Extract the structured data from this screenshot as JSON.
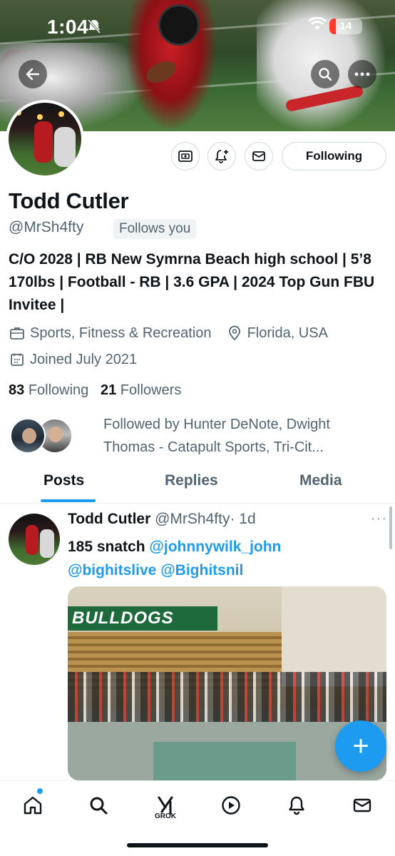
{
  "status_bar": {
    "time": "1:04",
    "battery": "14",
    "battery_level": 0.14
  },
  "profile": {
    "name": "Todd Cutler",
    "handle": "@MrSh4fty",
    "follows_you": "Follows you",
    "bio": "C/O 2028 | RB New Symrna Beach high school | 5’8 170lbs | Football - RB | 3.6 GPA | 2024 Top Gun FBU Invitee |",
    "category": "Sports, Fitness & Recreation",
    "location": "Florida, USA",
    "joined": "Joined July 2021",
    "following_count": "83",
    "following_label": "Following",
    "followers_count": "21",
    "followers_label": "Followers",
    "followed_by": "Followed by Hunter DeNote, Dwight Thomas - Catapult Sports, Tri-Cit..."
  },
  "actions": {
    "following_button": "Following"
  },
  "tabs": [
    {
      "label": "Posts",
      "active": true
    },
    {
      "label": "Replies",
      "active": false
    },
    {
      "label": "Media",
      "active": false
    }
  ],
  "post": {
    "author_name": "Todd Cutler",
    "author_handle": "@MrSh4fty",
    "time": "· 1d",
    "text": "185 snatch",
    "mention_1": "@johnnywilk_john",
    "mention_2": "@bighitslive",
    "mention_3": "@Bighitsnil",
    "more": "···",
    "video_banner_text": "BULLDOGS"
  },
  "fab_label": "+",
  "bottom_nav": {
    "grok_label": "GROK"
  },
  "icons": {
    "back": "arrow-left-icon",
    "search": "search-icon",
    "more": "more-horizontal-icon",
    "shop": "shop-icon",
    "notify": "bell-plus-icon",
    "message": "mail-icon",
    "category": "briefcase-icon",
    "location": "location-pin-icon",
    "joined": "calendar-icon",
    "nav": [
      "home-icon",
      "search-icon",
      "grok-icon",
      "play-icon",
      "bell-icon",
      "mail-icon"
    ]
  },
  "colors": {
    "accent": "#1d9bf0",
    "text": "#0f1419",
    "muted": "#536471",
    "battery": "#ff3b30"
  }
}
